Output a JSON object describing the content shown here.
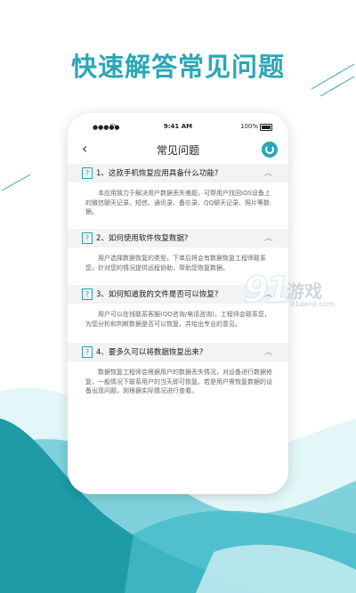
{
  "headline": "快速解答常见问题",
  "status_bar": {
    "time": "9:41 AM",
    "battery": "100%"
  },
  "nav": {
    "title": "常见问题",
    "back_icon": "chevron-left-icon",
    "service_icon": "customer-service-icon"
  },
  "faq": [
    {
      "question": "1、这款手机恢复应用具备什么功能?",
      "answer": "本应用致力于解决用户数据丢失难题，可帮用户找回iOS设备上的微信聊天记录、短信、通讯录、备忘录、QQ聊天记录、照片等数据。"
    },
    {
      "question": "2、如何使用软件恢复数据?",
      "answer": "用户选择数据恢复的类型，下单后将会有数据恢复工程师联系您，针对您的情况提供远程协助，帮助您恢复数据。"
    },
    {
      "question": "3、如何知道我的文件是否可以恢复?",
      "answer": "用户可以在线联系客服(QQ咨询/电话咨询)，工程师会联系您，为您分析和判断数据是否可以恢复，并给出专业的意见。"
    },
    {
      "question": "4、要多久可以将数据恢复出来?",
      "answer": "数据恢复工程师会根据用户的数据丢失情况，对设备进行数据修复，一般情况下联系用户的当天即可恢复。若是用户需恢复数据的设备出现问题，则根据实际情况进行查看。"
    }
  ],
  "watermark": {
    "brand_number": "91",
    "brand_name": "游戏",
    "url": "91danji.com"
  },
  "colors": {
    "accent": "#2aa7b5",
    "wave_dark": "#1f9aa7",
    "wave_light": "#bfeaf0"
  }
}
